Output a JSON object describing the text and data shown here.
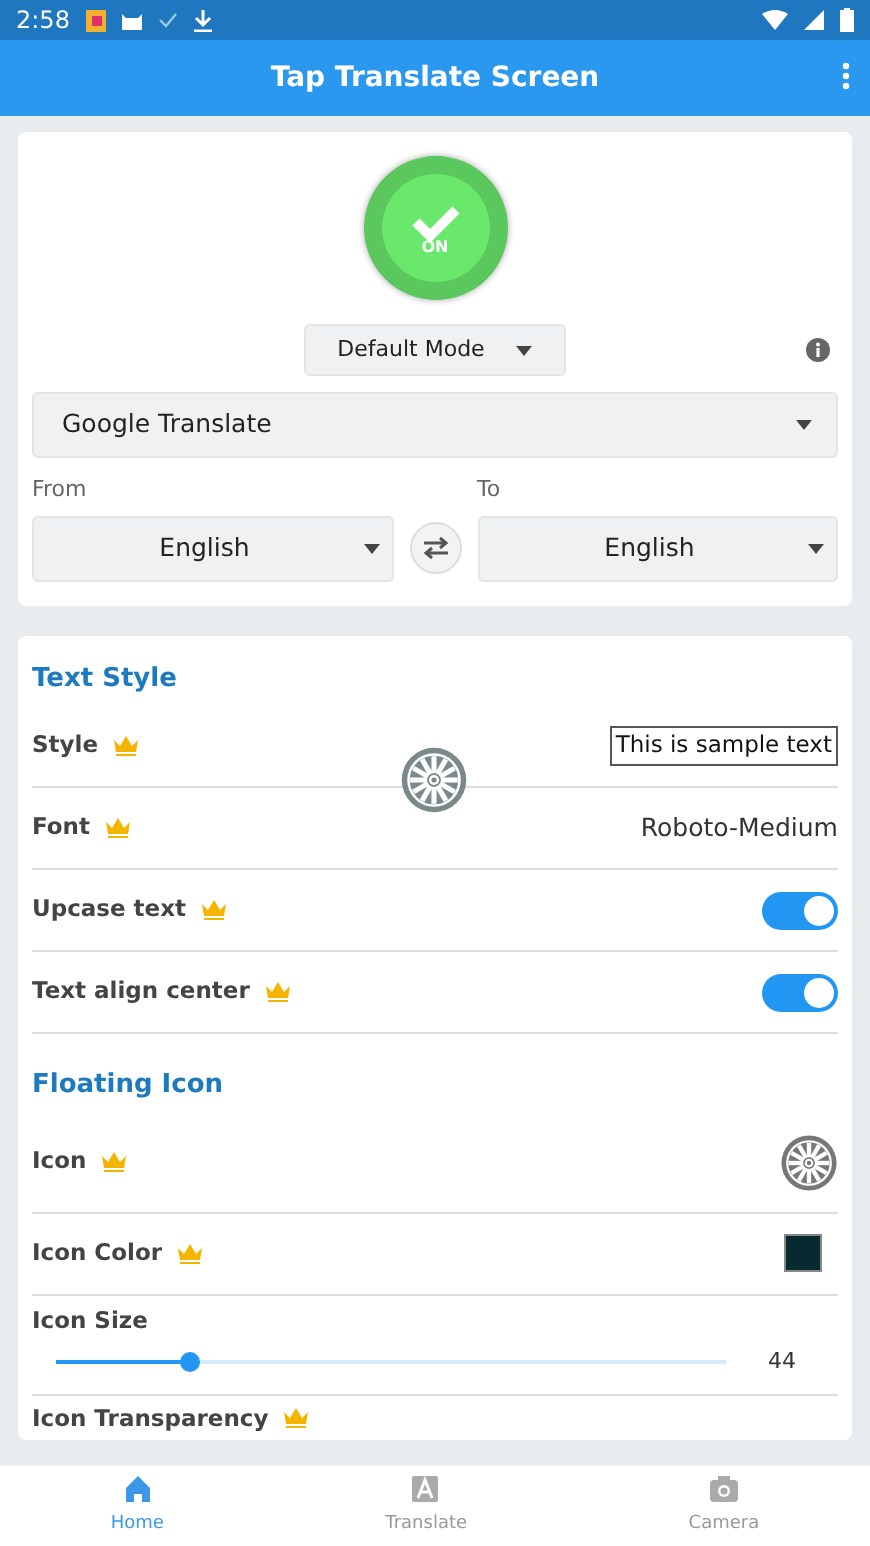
{
  "status_bar": {
    "time": "2:58"
  },
  "app_bar": {
    "title": "Tap Translate Screen"
  },
  "power": {
    "on": true,
    "label": "ON"
  },
  "mode": {
    "value": "Default Mode"
  },
  "translator": {
    "value": "Google Translate"
  },
  "from": {
    "label": "From",
    "value": "English"
  },
  "to": {
    "label": "To",
    "value": "English"
  },
  "sections": [
    {
      "title": "Text Style",
      "rows": [
        {
          "kind": "sample",
          "label": "Style",
          "premium": true,
          "value": "This is sample text"
        },
        {
          "kind": "text",
          "label": "Font",
          "premium": true,
          "value": "Roboto-Medium"
        },
        {
          "kind": "toggle",
          "label": "Upcase text",
          "premium": true,
          "on": true
        },
        {
          "kind": "toggle",
          "label": "Text align center",
          "premium": true,
          "on": true
        }
      ]
    },
    {
      "title": "Floating Icon",
      "rows": [
        {
          "kind": "icon",
          "label": "Icon",
          "premium": true
        },
        {
          "kind": "color",
          "label": "Icon Color",
          "premium": true,
          "color": "#062a30"
        },
        {
          "kind": "slider",
          "label": "Icon Size",
          "premium": false,
          "level": 0.2,
          "reading": "44"
        },
        {
          "kind": "plain",
          "label": "Icon Transparency",
          "premium": true
        }
      ]
    }
  ],
  "nav": [
    {
      "label": "Home",
      "selected": true
    },
    {
      "label": "Translate",
      "selected": false
    },
    {
      "label": "Camera",
      "selected": false
    }
  ]
}
